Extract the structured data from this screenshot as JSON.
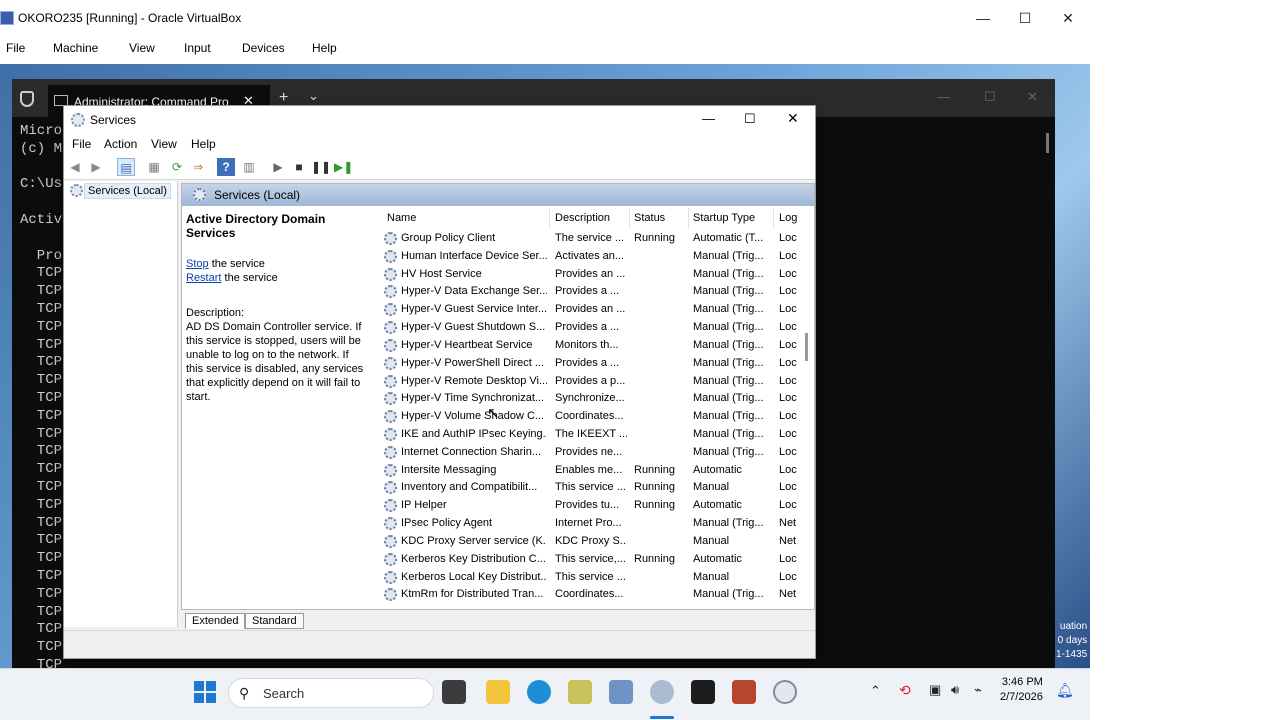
{
  "vbox": {
    "title": "OKORO235 [Running] - Oracle VirtualBox",
    "menu": [
      "File",
      "Machine",
      "View",
      "Input",
      "Devices",
      "Help"
    ],
    "minimize_glyph": "—",
    "maximize_glyph": "☐",
    "close_glyph": "✕"
  },
  "terminal": {
    "tab_title": "Administrator: Command Pro",
    "new_tab_glyph": "+",
    "dropdown_glyph": "⌄",
    "lines": [
      "Micro",
      "(c) M",
      "",
      "C:\\Us",
      "",
      "Activ",
      "",
      "  Pro",
      "  TCP",
      "  TCP",
      "  TCP",
      "  TCP",
      "  TCP",
      "  TCP",
      "  TCP",
      "  TCP",
      "  TCP",
      "  TCP",
      "  TCP",
      "  TCP",
      "  TCP",
      "  TCP",
      "  TCP",
      "  TCP",
      "  TCP",
      "  TCP",
      "  TCP",
      "  TCP",
      "  TCP",
      "  TCP",
      "  TCP",
      "  TCP"
    ],
    "watermark": [
      "uation",
      "0 days",
      "1-1435"
    ]
  },
  "services": {
    "title": "Services",
    "menu": [
      "File",
      "Action",
      "View",
      "Help"
    ],
    "tree_item": "Services (Local)",
    "pane_header": "Services (Local)",
    "selected_name": "Active Directory Domain Services",
    "stop_link": "Stop",
    "stop_rest": " the service",
    "restart_link": "Restart",
    "restart_rest": " the service",
    "description_label": "Description:",
    "description_lines": [
      "AD DS Domain Controller service. If",
      "this service is stopped, users will be",
      "unable to log on to the network. If",
      "this service is disabled, any services",
      "that explicitly depend on it will fail to",
      "start."
    ],
    "columns": [
      "Name",
      "Description",
      "Status",
      "Startup Type",
      "Log"
    ],
    "rows": [
      [
        "Group Policy Client",
        "The service ...",
        "Running",
        "Automatic (T...",
        "Loc"
      ],
      [
        "Human Interface Device Ser...",
        "Activates an...",
        "",
        "Manual (Trig...",
        "Loc"
      ],
      [
        "HV Host Service",
        "Provides an ...",
        "",
        "Manual (Trig...",
        "Loc"
      ],
      [
        "Hyper-V Data Exchange Ser...",
        "Provides a ...",
        "",
        "Manual (Trig...",
        "Loc"
      ],
      [
        "Hyper-V Guest Service Inter...",
        "Provides an ...",
        "",
        "Manual (Trig...",
        "Loc"
      ],
      [
        "Hyper-V Guest Shutdown S...",
        "Provides a ...",
        "",
        "Manual (Trig...",
        "Loc"
      ],
      [
        "Hyper-V Heartbeat Service",
        "Monitors th...",
        "",
        "Manual (Trig...",
        "Loc"
      ],
      [
        "Hyper-V PowerShell Direct ...",
        "Provides a ...",
        "",
        "Manual (Trig...",
        "Loc"
      ],
      [
        "Hyper-V Remote Desktop Vi...",
        "Provides a p...",
        "",
        "Manual (Trig...",
        "Loc"
      ],
      [
        "Hyper-V Time Synchronizat...",
        "Synchronize...",
        "",
        "Manual (Trig...",
        "Loc"
      ],
      [
        "Hyper-V Volume Shadow C...",
        "Coordinates...",
        "",
        "Manual (Trig...",
        "Loc"
      ],
      [
        "IKE and AuthIP IPsec Keying...",
        "The IKEEXT ...",
        "",
        "Manual (Trig...",
        "Loc"
      ],
      [
        "Internet Connection Sharin...",
        "Provides ne...",
        "",
        "Manual (Trig...",
        "Loc"
      ],
      [
        "Intersite Messaging",
        "Enables me...",
        "Running",
        "Automatic",
        "Loc"
      ],
      [
        "Inventory and Compatibilit...",
        "This service ...",
        "Running",
        "Manual",
        "Loc"
      ],
      [
        "IP Helper",
        "Provides tu...",
        "Running",
        "Automatic",
        "Loc"
      ],
      [
        "IPsec Policy Agent",
        "Internet Pro...",
        "",
        "Manual (Trig...",
        "Net"
      ],
      [
        "KDC Proxy Server service (K...",
        "KDC Proxy S...",
        "",
        "Manual",
        "Net"
      ],
      [
        "Kerberos Key Distribution C...",
        "This service,...",
        "Running",
        "Automatic",
        "Loc"
      ],
      [
        "Kerberos Local Key Distribut...",
        "This service ...",
        "",
        "Manual",
        "Loc"
      ],
      [
        "KtmRm for Distributed Tran...",
        "Coordinates...",
        "",
        "Manual (Trig...",
        "Net"
      ]
    ],
    "tabs": [
      "Extended",
      "Standard"
    ]
  },
  "taskbar": {
    "search_placeholder": "Search",
    "time": "3:46 PM",
    "date": "2/7/2026"
  }
}
